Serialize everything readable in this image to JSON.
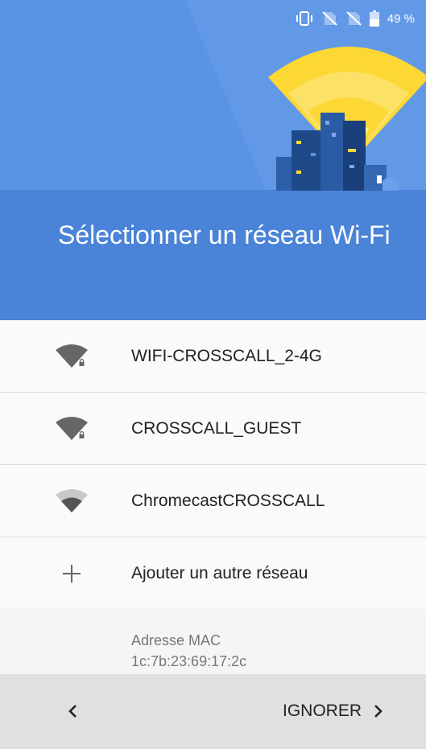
{
  "status_bar": {
    "battery_percent": "49 %",
    "icons": [
      "vibrate-icon",
      "no-sim-icon",
      "no-sim-icon",
      "battery-icon"
    ]
  },
  "header": {
    "title": "Sélectionner un réseau Wi-Fi",
    "colors": {
      "background": "#4d87dc",
      "wifi_fan": "#fdd835"
    }
  },
  "networks": [
    {
      "ssid": "WIFI-CROSSCALL_2-4G",
      "secured": true,
      "icon": "wifi-lock-icon"
    },
    {
      "ssid": "CROSSCALL_GUEST",
      "secured": true,
      "icon": "wifi-lock-icon"
    },
    {
      "ssid": "ChromecastCROSSCALL",
      "secured": false,
      "icon": "wifi-icon"
    }
  ],
  "add_network": {
    "label": "Ajouter un autre réseau",
    "icon": "plus-icon"
  },
  "mac": {
    "label": "Adresse MAC",
    "value": "1c:7b:23:69:17:2c"
  },
  "bottom_bar": {
    "back_icon": "chevron-left-icon",
    "skip_label": "IGNORER",
    "skip_icon": "chevron-right-icon"
  }
}
